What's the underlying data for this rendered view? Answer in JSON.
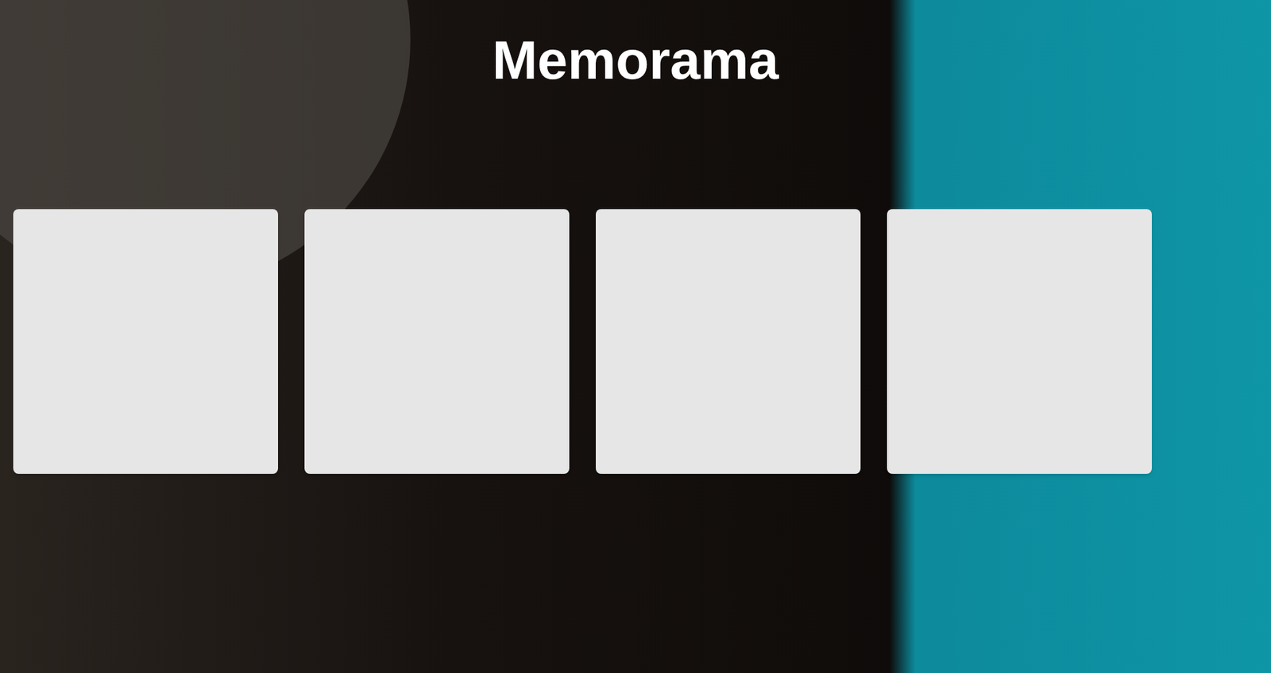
{
  "title": "Memorama",
  "cards": [
    {
      "flipped": false
    },
    {
      "flipped": false
    },
    {
      "flipped": false
    },
    {
      "flipped": false
    }
  ]
}
